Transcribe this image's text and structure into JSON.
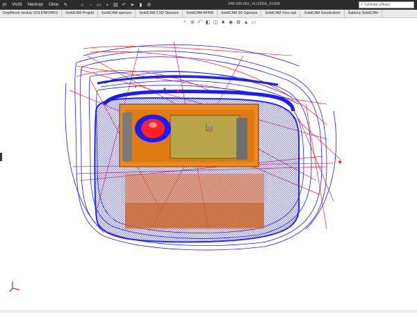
{
  "titlebar": {
    "menu": [
      "pt",
      "Vložit",
      "Nástroje",
      "Okno"
    ],
    "doc_title": "248-005-001_VLOŽKA_1530B",
    "search_placeholder": "Vyhledat příkazy"
  },
  "tabs": [
    "Doplňkové moduly SOLIDWORKS",
    "SolidCAM Projekt",
    "SolidCAM operace",
    "SolidCAM 2.5D Operace",
    "SolidCAM AFRM",
    "SolidCAM 3D Operace",
    "SolidCAM Více-osé",
    "SolidCAM Soustružení",
    "Šablony SolidCAM"
  ],
  "icons": {
    "toolbar": [
      "pin-icon",
      "home-icon",
      "new-file-icon",
      "open-folder-icon",
      "save-icon",
      "print-icon",
      "undo-icon",
      "select-arrow-icon",
      "rebuild-icon",
      "options-icon"
    ],
    "headsup": [
      "zoom-fit-icon",
      "zoom-area-icon",
      "previous-view-icon",
      "section-view-icon",
      "view-orientation-icon",
      "display-style-icon",
      "hide-show-icon",
      "edit-appearance-icon",
      "scene-icon",
      "view-settings-icon"
    ]
  },
  "colors": {
    "titlebar": "#2b2b2b",
    "toolpath_blue": "#1a1aff",
    "rapid_red": "#ff2020",
    "part_orange": "#f08a1e",
    "stock_gray": "#7a7a7a"
  }
}
